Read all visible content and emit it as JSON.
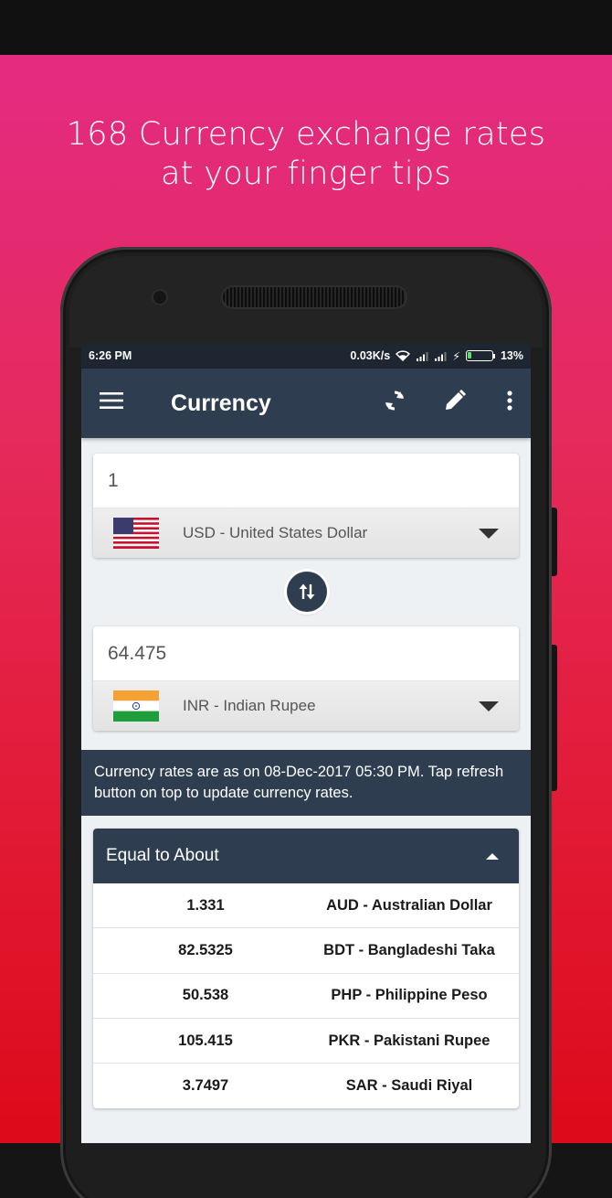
{
  "promo": {
    "headline_line1": "168 Currency exchange rates",
    "headline_line2": "at your finger tips"
  },
  "status_bar": {
    "time": "6:26 PM",
    "net_speed": "0.03K/s",
    "battery": "13%",
    "battery_color": "#5ee06b"
  },
  "app_bar": {
    "title": "Currency",
    "menu_icon": "menu-icon",
    "refresh_icon": "refresh-icon",
    "edit_icon": "edit-icon",
    "more_icon": "more-vert-icon",
    "color": "#2e3d50"
  },
  "from": {
    "amount": "1",
    "currency": "USD - United States Dollar",
    "flag": "us-flag-icon"
  },
  "to": {
    "amount": "64.475",
    "currency": "INR - Indian Rupee",
    "flag": "india-flag-icon"
  },
  "notice": "Currency rates are as on 08-Dec-2017 05:30 PM. Tap refresh button on top to update currency rates.",
  "equal": {
    "title": "Equal to About",
    "rows": [
      {
        "value": "1.331",
        "currency": "AUD - Australian Dollar"
      },
      {
        "value": "82.5325",
        "currency": "BDT - Bangladeshi Taka"
      },
      {
        "value": "50.538",
        "currency": "PHP - Philippine Peso"
      },
      {
        "value": "105.415",
        "currency": "PKR - Pakistani Rupee"
      },
      {
        "value": "3.7497",
        "currency": "SAR - Saudi Riyal"
      }
    ]
  }
}
